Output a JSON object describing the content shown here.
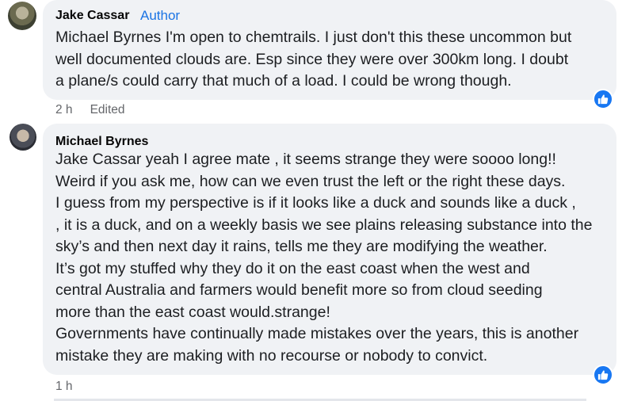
{
  "comments": [
    {
      "author": "Jake Cassar",
      "badge": "Author",
      "lines": [
        "Michael Byrnes I'm open to chemtrails. I just don't this these uncommon but",
        "well documented clouds are. Esp since they were over 300km long. I doubt",
        "a plane/s could carry that much of a load. I could be wrong though."
      ],
      "time": "2 h",
      "edited": "Edited",
      "reaction_icon": "like-icon"
    },
    {
      "author": "Michael Byrnes",
      "lines": [
        "Jake Cassar yeah I agree mate , it seems strange they were soooo long!!",
        "Weird if you ask me, how can we even trust the left or the right these days.",
        "I guess from my perspective is if it looks like a duck and sounds like a duck ,",
        ", it is a duck, and on a weekly basis we see plains releasing substance into the",
        "sky’s and then next day it rains, tells me they are modifying the weather.",
        "It’s got my stuffed why they do it on the east coast when the west and",
        "central Australia and farmers would benefit more so from cloud seeding",
        "more than the east coast would.strange!",
        "Governments have continually made mistakes over the years, this is another",
        "mistake they are making with no recourse or nobody to convict."
      ],
      "time": "1 h",
      "reaction_icon": "like-icon"
    }
  ],
  "colors": {
    "bubble": "#f0f2f5",
    "author_badge": "#1b74e4",
    "like": "#1877f2",
    "meta": "#65676b"
  }
}
